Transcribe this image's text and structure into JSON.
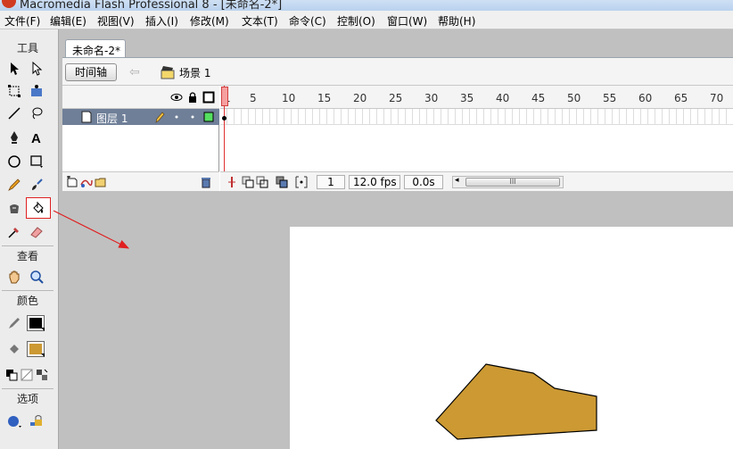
{
  "window": {
    "title": "Macromedia Flash Professional 8 - [未命名-2*]"
  },
  "menu": [
    "文件(F)",
    "编辑(E)",
    "视图(V)",
    "插入(I)",
    "修改(M)",
    "文本(T)",
    "命令(C)",
    "控制(O)",
    "窗口(W)",
    "帮助(H)"
  ],
  "toolbox": {
    "tools_header": "工具",
    "view_header": "查看",
    "colors_header": "颜色",
    "options_header": "选项",
    "stroke_color": "#000000",
    "fill_color": "#cc9933"
  },
  "document": {
    "tab_label": "未命名-2*",
    "timeline_button": "时间轴",
    "scene_label": "场景 1"
  },
  "timeline": {
    "ruler_labels": [
      "1",
      "5",
      "10",
      "15",
      "20",
      "25",
      "30",
      "35",
      "40",
      "45",
      "50",
      "55",
      "60",
      "65",
      "70"
    ],
    "layer_name": "图层 1",
    "current_frame": "1",
    "frame_rate": "12.0 fps",
    "elapsed_time": "0.0s",
    "scroll_thumb": "III"
  },
  "stage": {
    "shape_fill": "#cc9933",
    "shape_stroke": "#000000"
  }
}
